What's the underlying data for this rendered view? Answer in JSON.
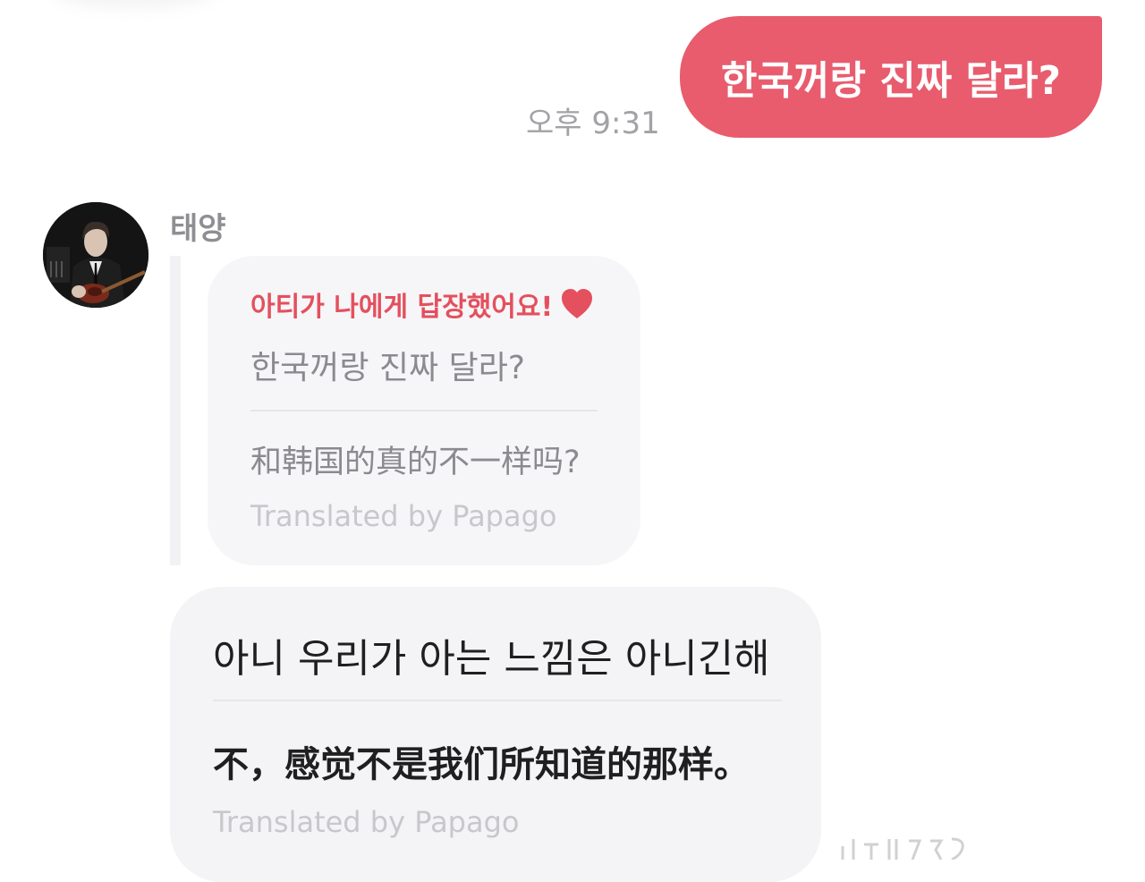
{
  "outgoing_message": {
    "text": "한국꺼랑 진짜 달라?",
    "time": "오후 9:31",
    "bubble_color": "#e85c6e"
  },
  "incoming": {
    "sender_name": "태양",
    "avatar": "profile-photo-man-with-guitar",
    "quote": {
      "header": "아티가 나에게 답장했어요!",
      "header_icon": "heart-icon",
      "header_color": "#e4505e",
      "original": "한국꺼랑 진짜 달라?",
      "translated": "和韩国的真的不一样吗?",
      "credit": "Translated by Papago"
    },
    "reply": {
      "original": "아니 우리가 아는 느낌은 아니긴해",
      "translated": "不，感觉不是我们所知道的那样。",
      "credit": "Translated by Papago"
    }
  }
}
